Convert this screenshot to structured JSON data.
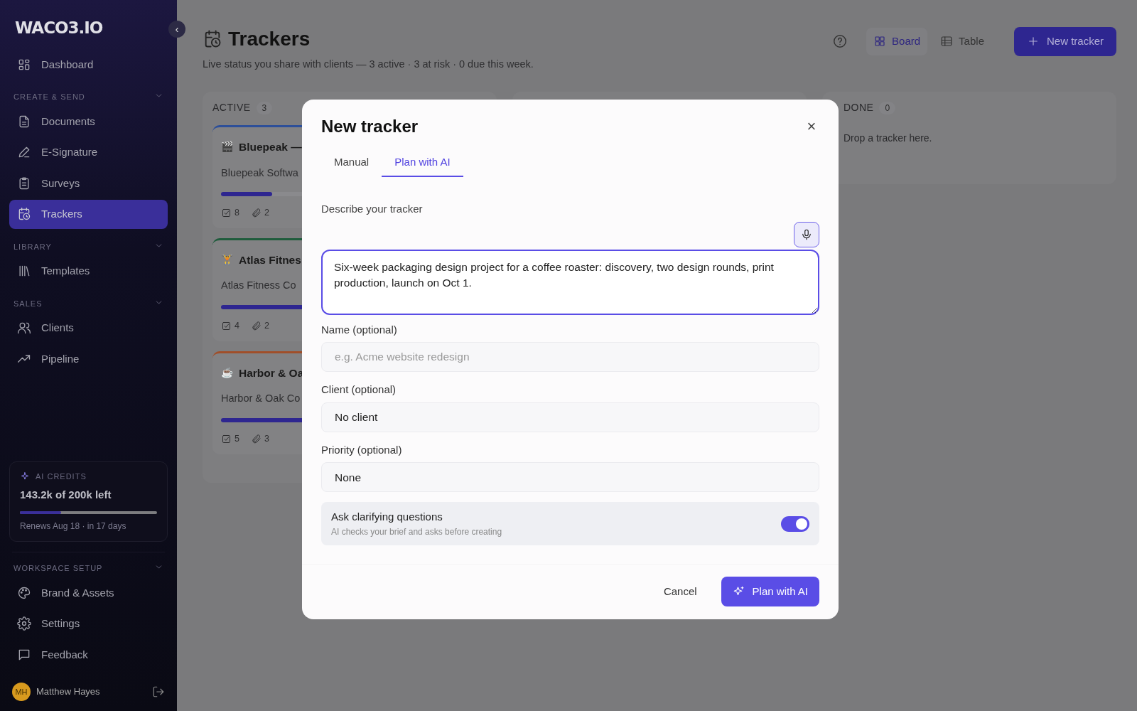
{
  "sidebar": {
    "logo": "WACO3.IO",
    "collapse_icon": "‹",
    "sections": [
      {
        "items": [
          {
            "label": "Dashboard",
            "selected": false
          }
        ]
      },
      {
        "heading": "CREATE & SEND",
        "items": [
          {
            "label": "Documents",
            "selected": false
          },
          {
            "label": "E-Signature",
            "selected": false
          },
          {
            "label": "Surveys",
            "selected": false
          },
          {
            "label": "Trackers",
            "selected": true
          }
        ]
      },
      {
        "heading": "LIBRARY",
        "items": [
          {
            "label": "Templates",
            "selected": false
          }
        ]
      },
      {
        "heading": "SALES",
        "items": [
          {
            "label": "Clients",
            "selected": false
          },
          {
            "label": "Pipeline",
            "selected": false
          }
        ]
      }
    ],
    "credits": {
      "label": "AI CREDITS",
      "amount": "143.2k of 200k left",
      "level": 0.3,
      "renews": "Renews Aug 18 · in 17 days"
    },
    "setup": {
      "heading": "WORKSPACE SETUP",
      "items": [
        {
          "label": "Brand & Assets",
          "selected": false
        },
        {
          "label": "Settings",
          "selected": false
        },
        {
          "label": "Feedback",
          "selected": false
        }
      ]
    },
    "user": {
      "initials": "MH",
      "name": "Matthew Hayes"
    }
  },
  "header": {
    "title": "Trackers",
    "subtitle": "Live status you share with clients — 3 active · 3 at risk · 0 due this week.",
    "views": [
      {
        "label": "Board",
        "selected": true
      },
      {
        "label": "Table",
        "selected": false
      }
    ],
    "new_button": "New tracker"
  },
  "board": {
    "columns": [
      {
        "title": "ACTIVE",
        "count": "3",
        "cards": [
          {
            "emoji": "🎬",
            "title": "Bluepeak —",
            "client": "Bluepeak Softwa",
            "color": "#2d4f99",
            "level": 0.2,
            "tasks": "8",
            "files": "2"
          },
          {
            "emoji": "🏋",
            "title": "Atlas Fitnes",
            "client": "Atlas Fitness Co",
            "color": "#1f5c3c",
            "level": 0.4,
            "tasks": "4",
            "files": "2"
          },
          {
            "emoji": "☕",
            "title": "Harbor & Oa",
            "client": "Harbor & Oak Co",
            "color": "#a04f2a",
            "level": 0.4,
            "tasks": "5",
            "files": "3"
          }
        ]
      },
      {},
      {
        "title": "DONE",
        "count": "0",
        "empty_text": "Drop a tracker here."
      }
    ]
  },
  "modal": {
    "title": "New tracker",
    "close": "×",
    "tabs": [
      {
        "label": "Manual",
        "selected": false
      },
      {
        "label": "Plan with AI",
        "selected": true
      }
    ],
    "describe_label": "Describe your tracker",
    "description": "Six-week packaging design project for a coffee roaster: discovery, two design rounds, print production, launch on Oct 1.",
    "name": {
      "label": "Name (optional)",
      "placeholder": "e.g. Acme website redesign"
    },
    "client": {
      "label": "Client (optional)",
      "value": "No client"
    },
    "priority": {
      "label": "Priority (optional)",
      "value": "None"
    },
    "clarify": {
      "title": "Ask clarifying questions",
      "hint": "AI checks your brief and asks before creating",
      "on": true
    },
    "cancel": "Cancel",
    "submit": "Plan with AI"
  }
}
